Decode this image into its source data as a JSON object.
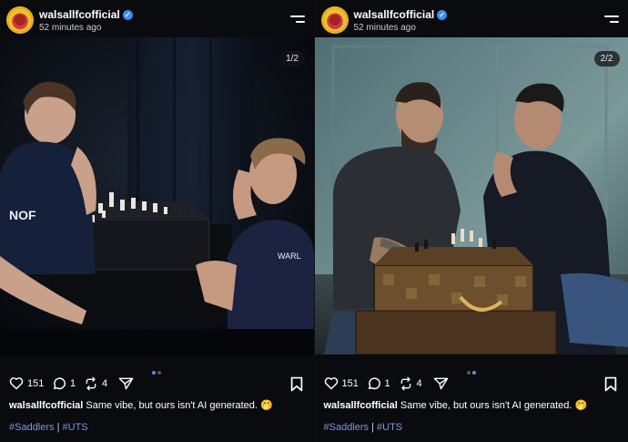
{
  "posts": [
    {
      "username": "walsallfcofficial",
      "time": "52 minutes ago",
      "counter": "1/2",
      "likes": "151",
      "comments": "1",
      "reposts": "4",
      "caption_user": "walsallfcofficial",
      "caption_text": " Same vibe, but ours isn't AI generated. 🤭",
      "tag1": "#Saddlers",
      "separator": " | ",
      "tag2": "#UTS"
    },
    {
      "username": "walsallfcofficial",
      "time": "52 minutes ago",
      "counter": "2/2",
      "likes": "151",
      "comments": "1",
      "reposts": "4",
      "caption_user": "walsallfcofficial",
      "caption_text": " Same vibe, but ours isn't AI generated. 🤭",
      "tag1": "#Saddlers",
      "separator": " | ",
      "tag2": "#UTS"
    }
  ],
  "colors": {
    "accent": "#5b8cf0",
    "hashtag": "#7d97e8",
    "verified": "#3b8ef2",
    "background": "#0a0b0f"
  },
  "icons": [
    "heart-icon",
    "comment-icon",
    "repost-icon",
    "share-icon",
    "bookmark-icon",
    "menu-icon",
    "verified-icon"
  ]
}
